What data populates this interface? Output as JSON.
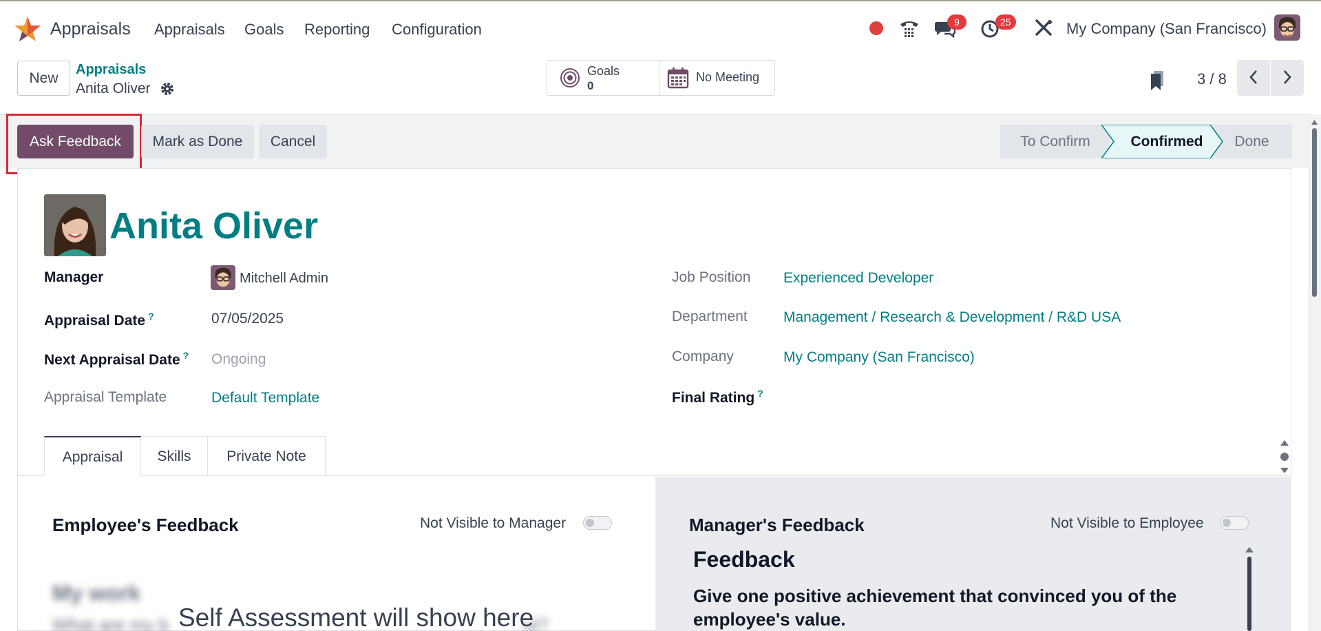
{
  "topnav": {
    "app_title": "Appraisals",
    "menu": [
      "Appraisals",
      "Goals",
      "Reporting",
      "Configuration"
    ],
    "messages_count": "9",
    "activities_count": "25",
    "company": "My Company (San Francisco)"
  },
  "control_panel": {
    "new_label": "New",
    "breadcrumb_root": "Appraisals",
    "breadcrumb_current": "Anita Oliver",
    "goals_label": "Goals",
    "goals_value": "0",
    "meeting_label": "No Meeting",
    "pager": "3 / 8"
  },
  "statusbar": {
    "ask_feedback": "Ask Feedback",
    "mark_done": "Mark as Done",
    "cancel": "Cancel",
    "stages": [
      "To Confirm",
      "Confirmed",
      "Done"
    ],
    "active_stage": "Confirmed"
  },
  "employee": {
    "name": "Anita Oliver",
    "fields": {
      "manager_label": "Manager",
      "manager_value": "Mitchell Admin",
      "appraisal_date_label": "Appraisal Date",
      "appraisal_date_value": "07/05/2025",
      "next_date_label": "Next Appraisal Date",
      "next_date_value": "Ongoing",
      "template_label": "Appraisal Template",
      "template_value": "Default Template",
      "job_label": "Job Position",
      "job_value": "Experienced Developer",
      "department_label": "Department",
      "department_value": "Management / Research & Development / R&D USA",
      "company_label": "Company",
      "company_value": "My Company (San Francisco)",
      "final_rating_label": "Final Rating",
      "help_mark": "?"
    }
  },
  "tabs": [
    "Appraisal",
    "Skills",
    "Private Note"
  ],
  "feedback": {
    "employee_title": "Employee's Feedback",
    "employee_visibility": "Not Visible to Manager",
    "employee_blur_title": "My work",
    "employee_blur_text": "What are my b",
    "employee_blur_text_end": "ut?",
    "self_assessment": "Self Assessment will show here",
    "manager_title": "Manager's Feedback",
    "manager_visibility": "Not Visible to Employee",
    "manager_heading": "Feedback",
    "manager_question": "Give one positive achievement that convinced you of the employee's value."
  },
  "colors": {
    "brand": "#714b67",
    "link": "#017e84",
    "badge": "#e4393f",
    "highlight": "#d62a32"
  }
}
